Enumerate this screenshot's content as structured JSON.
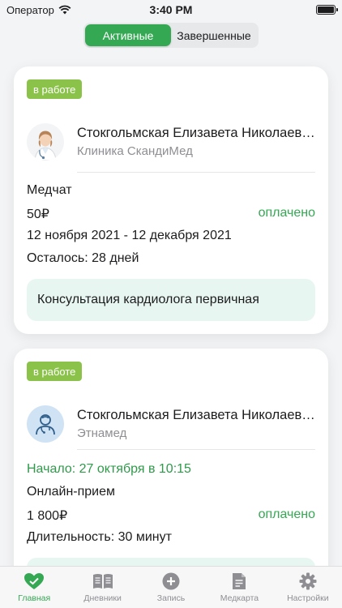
{
  "status_bar": {
    "carrier": "Оператор",
    "time": "3:40 PM"
  },
  "segments": [
    {
      "label": "Активные",
      "active": true
    },
    {
      "label": "Завершенные",
      "active": false
    }
  ],
  "cards": [
    {
      "badge": "в работе",
      "doctor_name": "Стокгольмская Елизавета Николаевна",
      "clinic": "Клиника СкандиМед",
      "service_type": "Медчат",
      "price": "50₽",
      "payment_status": "оплачено",
      "period": "12 ноября 2021 - 12 декабря 2021",
      "remaining": "Осталось: 28 дней",
      "service_name": "Консультация кардиолога первичная"
    },
    {
      "badge": "в работе",
      "doctor_name": "Стокгольмская Елизавета Николаевна",
      "clinic": "Этнамед",
      "start": "Начало: 27 октября в 10:15",
      "service_type": "Онлайн-прием",
      "price": "1 800₽",
      "payment_status": "оплачено",
      "duration": "Длительность: 30 минут"
    }
  ],
  "tabbar": [
    {
      "label": "Главная",
      "icon": "heart-icon",
      "active": true
    },
    {
      "label": "Дневники",
      "icon": "book-icon",
      "active": false
    },
    {
      "label": "Запись",
      "icon": "plus-circle-icon",
      "active": false
    },
    {
      "label": "Медкарта",
      "icon": "document-icon",
      "active": false
    },
    {
      "label": "Настройки",
      "icon": "gear-icon",
      "active": false
    }
  ],
  "colors": {
    "accent": "#34a853",
    "badge": "#8bc34a",
    "service_box": "#e8f6f1"
  }
}
